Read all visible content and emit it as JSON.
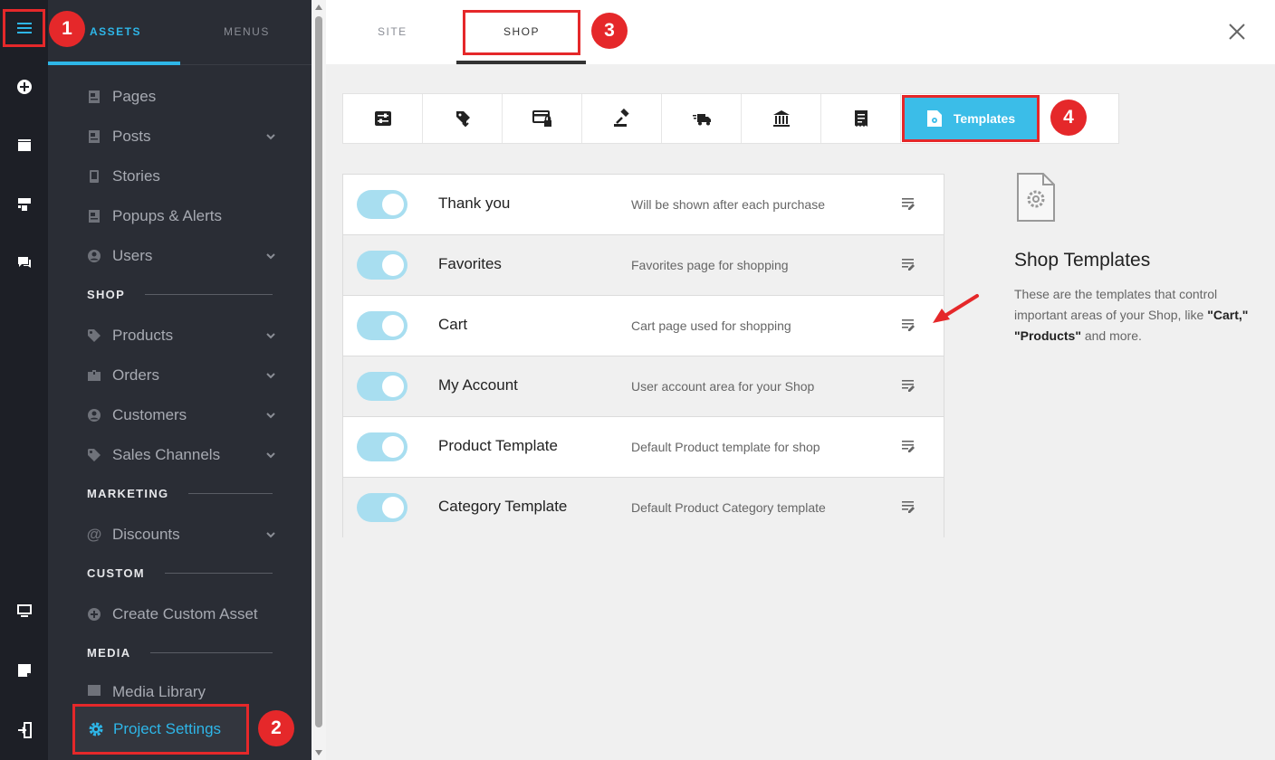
{
  "left_rail": {
    "icons": [
      "menu-icon",
      "add-icon",
      "layers-icon",
      "widgets-icon",
      "chat-icon",
      "monitor-icon",
      "note-icon",
      "exit-icon"
    ]
  },
  "panel": {
    "tabs": {
      "assets": "ASSETS",
      "menus": "MENUS"
    },
    "items": [
      {
        "label": "Pages",
        "icon": "page-icon"
      },
      {
        "label": "Posts",
        "icon": "page-icon"
      },
      {
        "label": "Stories",
        "icon": "story-icon"
      },
      {
        "label": "Popups & Alerts",
        "icon": "page-icon"
      },
      {
        "label": "Users",
        "icon": "user-icon"
      },
      {
        "label": "Products",
        "icon": "tag-icon"
      },
      {
        "label": "Orders",
        "icon": "box-icon"
      },
      {
        "label": "Customers",
        "icon": "user-icon"
      },
      {
        "label": "Sales Channels",
        "icon": "tag-icon"
      },
      {
        "label": "Discounts",
        "icon": "at-icon"
      },
      {
        "label": "Create Custom Asset",
        "icon": "plus-circle-icon"
      },
      {
        "label": "Media Library",
        "icon": "image-icon"
      }
    ],
    "sections": {
      "shop": "SHOP",
      "marketing": "MARKETING",
      "custom": "CUSTOM",
      "media": "MEDIA"
    },
    "project_settings": "Project Settings"
  },
  "main": {
    "tabs": {
      "site": "SITE",
      "shop": "SHOP"
    },
    "templates_label": "Templates",
    "rows": [
      {
        "name": "Thank you",
        "desc": "Will be shown after each purchase",
        "enabled": true
      },
      {
        "name": "Favorites",
        "desc": "Favorites page for shopping",
        "enabled": true
      },
      {
        "name": "Cart",
        "desc": "Cart page used for shopping",
        "enabled": true
      },
      {
        "name": "My Account",
        "desc": "User account area for your Shop",
        "enabled": true
      },
      {
        "name": "Product Template",
        "desc": "Default Product template for shop",
        "enabled": true
      },
      {
        "name": "Category Template",
        "desc": "Default Product Category template",
        "enabled": true
      }
    ],
    "info": {
      "title": "Shop Templates",
      "desc_start": "These are the templates that control important areas of your Shop, like",
      "desc_q1": "\"Cart,\"",
      "desc_q2": "\"Products\"",
      "desc_end": "and more."
    }
  },
  "badges": {
    "b1": "1",
    "b2": "2",
    "b3": "3",
    "b4": "4"
  },
  "colors": {
    "accent": "#2eb6e8",
    "highlight": "#e5282a",
    "panel_bg": "#2a2d35",
    "rail_bg": "#1d1f26"
  }
}
